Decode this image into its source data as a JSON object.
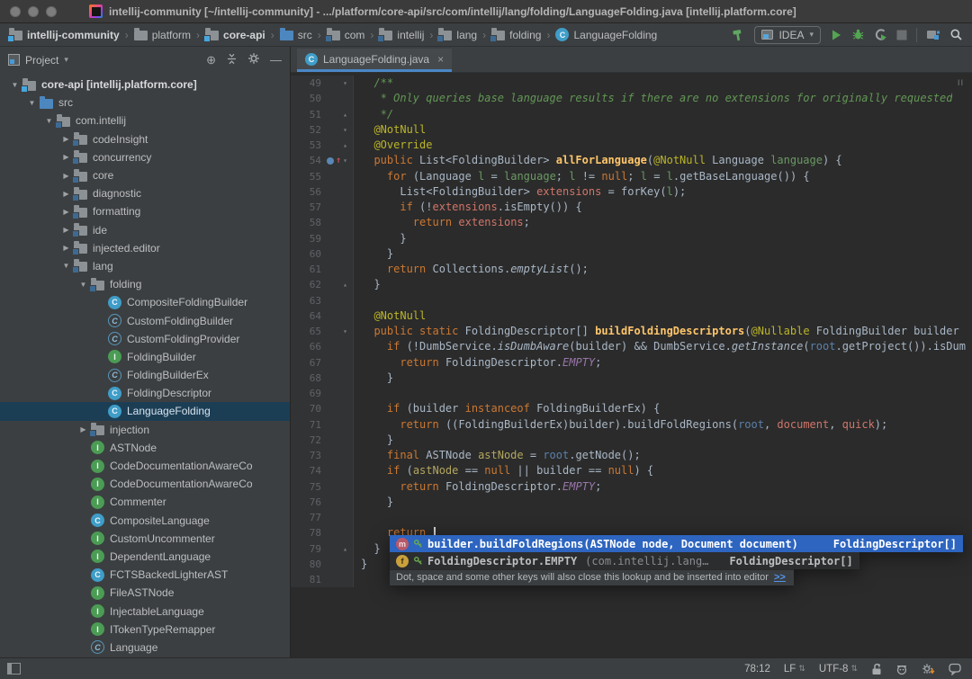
{
  "window": {
    "title": "intellij-community [~/intellij-community] - .../platform/core-api/src/com/intellij/lang/folding/LanguageFolding.java [intellij.platform.core]"
  },
  "glyphs": {
    "expanded": "▼",
    "collapsed": "▶",
    "fold_open": "▾",
    "fold_close": "▴",
    "breadcrumb_sep": "›",
    "dropdown_arrow": "▾",
    "tab_close": "×",
    "updown": "⇅",
    "minus": "—",
    "crosshair": "⊕",
    "override_arrow": "↑"
  },
  "icon_letters": {
    "class": "C",
    "abstract": "C",
    "interface": "I",
    "method": "m",
    "field": "f"
  },
  "colors": {
    "accent_blue": "#4a88c7",
    "tree_selection": "#1c3e55",
    "popup_selection": "#2d65c0",
    "run_green": "#53a552"
  },
  "navbar": {
    "breadcrumbs": [
      {
        "label": "intellij-community",
        "icon": "module",
        "bold": true
      },
      {
        "label": "platform",
        "icon": "folder"
      },
      {
        "label": "core-api",
        "icon": "module",
        "bold": true
      },
      {
        "label": "src",
        "icon": "src"
      },
      {
        "label": "com",
        "icon": "package"
      },
      {
        "label": "intellij",
        "icon": "package"
      },
      {
        "label": "lang",
        "icon": "package"
      },
      {
        "label": "folding",
        "icon": "package"
      },
      {
        "label": "LanguageFolding",
        "icon": "class"
      }
    ],
    "run_config_label": "IDEA"
  },
  "project_panel": {
    "title": "Project",
    "tree": [
      {
        "label": "core-api [intellij.platform.core]",
        "level": 0,
        "arrow": "e",
        "icon": "module",
        "bold": true
      },
      {
        "label": "src",
        "level": 1,
        "arrow": "e",
        "icon": "src"
      },
      {
        "label": "com.intellij",
        "level": 2,
        "arrow": "e",
        "icon": "package"
      },
      {
        "label": "codeInsight",
        "level": 3,
        "arrow": "c",
        "icon": "package"
      },
      {
        "label": "concurrency",
        "level": 3,
        "arrow": "c",
        "icon": "package"
      },
      {
        "label": "core",
        "level": 3,
        "arrow": "c",
        "icon": "package"
      },
      {
        "label": "diagnostic",
        "level": 3,
        "arrow": "c",
        "icon": "package"
      },
      {
        "label": "formatting",
        "level": 3,
        "arrow": "c",
        "icon": "package"
      },
      {
        "label": "ide",
        "level": 3,
        "arrow": "c",
        "icon": "package"
      },
      {
        "label": "injected.editor",
        "level": 3,
        "arrow": "c",
        "icon": "package"
      },
      {
        "label": "lang",
        "level": 3,
        "arrow": "e",
        "icon": "package"
      },
      {
        "label": "folding",
        "level": 4,
        "arrow": "e",
        "icon": "package"
      },
      {
        "label": "CompositeFoldingBuilder",
        "level": 5,
        "icon": "class"
      },
      {
        "label": "CustomFoldingBuilder",
        "level": 5,
        "icon": "abstract"
      },
      {
        "label": "CustomFoldingProvider",
        "level": 5,
        "icon": "abstract"
      },
      {
        "label": "FoldingBuilder",
        "level": 5,
        "icon": "interface"
      },
      {
        "label": "FoldingBuilderEx",
        "level": 5,
        "icon": "abstract"
      },
      {
        "label": "FoldingDescriptor",
        "level": 5,
        "icon": "class"
      },
      {
        "label": "LanguageFolding",
        "level": 5,
        "icon": "class",
        "selected": true
      },
      {
        "label": "injection",
        "level": 4,
        "arrow": "c",
        "icon": "package"
      },
      {
        "label": "ASTNode",
        "level": 4,
        "icon": "interface"
      },
      {
        "label": "CodeDocumentationAwareCo",
        "level": 4,
        "icon": "interface"
      },
      {
        "label": "CodeDocumentationAwareCo",
        "level": 4,
        "icon": "interface"
      },
      {
        "label": "Commenter",
        "level": 4,
        "icon": "interface"
      },
      {
        "label": "CompositeLanguage",
        "level": 4,
        "icon": "class"
      },
      {
        "label": "CustomUncommenter",
        "level": 4,
        "icon": "interface"
      },
      {
        "label": "DependentLanguage",
        "level": 4,
        "icon": "interface"
      },
      {
        "label": "FCTSBackedLighterAST",
        "level": 4,
        "icon": "class"
      },
      {
        "label": "FileASTNode",
        "level": 4,
        "icon": "interface"
      },
      {
        "label": "InjectableLanguage",
        "level": 4,
        "icon": "interface"
      },
      {
        "label": "ITokenTypeRemapper",
        "level": 4,
        "icon": "interface"
      },
      {
        "label": "Language",
        "level": 4,
        "icon": "abstract"
      }
    ]
  },
  "editor": {
    "tab_label": "LanguageFolding.java",
    "stripe_marker": "II",
    "lines": [
      {
        "n": 49,
        "f": "o",
        "s": [
          [
            "  /**",
            "c"
          ]
        ]
      },
      {
        "n": 50,
        "s": [
          [
            "   * Only queries base language results if there are no extensions for originally requested",
            "c"
          ]
        ]
      },
      {
        "n": 51,
        "f": "c",
        "s": [
          [
            "   */",
            "c"
          ]
        ]
      },
      {
        "n": 52,
        "f": "o",
        "s": [
          [
            "  ",
            "d"
          ],
          [
            "@NotNull",
            "a"
          ]
        ]
      },
      {
        "n": 53,
        "f": "c",
        "s": [
          [
            "  ",
            "d"
          ],
          [
            "@Override",
            "a"
          ]
        ]
      },
      {
        "n": 54,
        "f": "o",
        "ov": true,
        "s": [
          [
            "  ",
            "d"
          ],
          [
            "public ",
            "k"
          ],
          [
            "List<FoldingBuilder> ",
            "d"
          ],
          [
            "allForLanguage",
            "m"
          ],
          [
            "(",
            "d"
          ],
          [
            "@NotNull",
            "a"
          ],
          [
            " Language ",
            "d"
          ],
          [
            "language",
            "vg"
          ],
          [
            ") {",
            "d"
          ]
        ]
      },
      {
        "n": 55,
        "s": [
          [
            "    ",
            "d"
          ],
          [
            "for",
            "k"
          ],
          [
            " (Language ",
            "d"
          ],
          [
            "l",
            "vg"
          ],
          [
            " = ",
            "d"
          ],
          [
            "language",
            "vg"
          ],
          [
            "; ",
            "d"
          ],
          [
            "l",
            "vg"
          ],
          [
            " != ",
            "d"
          ],
          [
            "null",
            "k"
          ],
          [
            "; ",
            "d"
          ],
          [
            "l",
            "vg"
          ],
          [
            " = ",
            "d"
          ],
          [
            "l",
            "vg"
          ],
          [
            ".getBaseLanguage()) {",
            "d"
          ]
        ]
      },
      {
        "n": 56,
        "s": [
          [
            "      List<FoldingBuilder> ",
            "d"
          ],
          [
            "extensions",
            "vs"
          ],
          [
            " = forKey(",
            "d"
          ],
          [
            "l",
            "vg"
          ],
          [
            ");",
            "d"
          ]
        ]
      },
      {
        "n": 57,
        "s": [
          [
            "      ",
            "d"
          ],
          [
            "if",
            "k"
          ],
          [
            " (!",
            "d"
          ],
          [
            "extensions",
            "vs"
          ],
          [
            ".isEmpty()) {",
            "d"
          ]
        ]
      },
      {
        "n": 58,
        "s": [
          [
            "        ",
            "d"
          ],
          [
            "return",
            "k"
          ],
          [
            " ",
            "d"
          ],
          [
            "extensions",
            "vs"
          ],
          [
            ";",
            "d"
          ]
        ]
      },
      {
        "n": 59,
        "s": [
          [
            "      }",
            "d"
          ]
        ]
      },
      {
        "n": 60,
        "s": [
          [
            "    }",
            "d"
          ]
        ]
      },
      {
        "n": 61,
        "s": [
          [
            "    ",
            "d"
          ],
          [
            "return",
            "k"
          ],
          [
            " Collections.",
            "d"
          ],
          [
            "emptyList",
            "st"
          ],
          [
            "();",
            "d"
          ]
        ]
      },
      {
        "n": 62,
        "f": "c",
        "s": [
          [
            "  }",
            "d"
          ]
        ]
      },
      {
        "n": 63,
        "s": []
      },
      {
        "n": 64,
        "s": [
          [
            "  ",
            "d"
          ],
          [
            "@NotNull",
            "a"
          ]
        ]
      },
      {
        "n": 65,
        "f": "o",
        "s": [
          [
            "  ",
            "d"
          ],
          [
            "public static ",
            "k"
          ],
          [
            "FoldingDescriptor[] ",
            "d"
          ],
          [
            "buildFoldingDescriptors",
            "m"
          ],
          [
            "(",
            "d"
          ],
          [
            "@Nullable",
            "a"
          ],
          [
            " FoldingBuilder builder",
            "d"
          ]
        ]
      },
      {
        "n": 66,
        "s": [
          [
            "    ",
            "d"
          ],
          [
            "if",
            "k"
          ],
          [
            " (!DumbService.",
            "d"
          ],
          [
            "isDumbAware",
            "st"
          ],
          [
            "(builder) && DumbService.",
            "d"
          ],
          [
            "getInstance",
            "st"
          ],
          [
            "(",
            "d"
          ],
          [
            "root",
            "vb"
          ],
          [
            ".getProject()).isDum",
            "d"
          ]
        ]
      },
      {
        "n": 67,
        "s": [
          [
            "      ",
            "d"
          ],
          [
            "return",
            "k"
          ],
          [
            " FoldingDescriptor.",
            "d"
          ],
          [
            "EMPTY",
            "p"
          ],
          [
            ";",
            "d"
          ]
        ]
      },
      {
        "n": 68,
        "s": [
          [
            "    }",
            "d"
          ]
        ]
      },
      {
        "n": 69,
        "s": []
      },
      {
        "n": 70,
        "s": [
          [
            "    ",
            "d"
          ],
          [
            "if",
            "k"
          ],
          [
            " (builder ",
            "d"
          ],
          [
            "instanceof",
            "k"
          ],
          [
            " FoldingBuilderEx) {",
            "d"
          ]
        ]
      },
      {
        "n": 71,
        "s": [
          [
            "      ",
            "d"
          ],
          [
            "return",
            "k"
          ],
          [
            " ((FoldingBuilderEx)builder).buildFoldRegions(",
            "d"
          ],
          [
            "root",
            "vb"
          ],
          [
            ", ",
            "d"
          ],
          [
            "document",
            "vs"
          ],
          [
            ", ",
            "d"
          ],
          [
            "quick",
            "vs"
          ],
          [
            ");",
            "d"
          ]
        ]
      },
      {
        "n": 72,
        "s": [
          [
            "    }",
            "d"
          ]
        ]
      },
      {
        "n": 73,
        "s": [
          [
            "    ",
            "d"
          ],
          [
            "final ",
            "k"
          ],
          [
            "ASTNode ",
            "d"
          ],
          [
            "astNode",
            "vy"
          ],
          [
            " = ",
            "d"
          ],
          [
            "root",
            "vb"
          ],
          [
            ".getNode();",
            "d"
          ]
        ]
      },
      {
        "n": 74,
        "s": [
          [
            "    ",
            "d"
          ],
          [
            "if",
            "k"
          ],
          [
            " (",
            "d"
          ],
          [
            "astNode",
            "vy"
          ],
          [
            " == ",
            "d"
          ],
          [
            "null",
            "k"
          ],
          [
            " || builder == ",
            "d"
          ],
          [
            "null",
            "k"
          ],
          [
            ") {",
            "d"
          ]
        ]
      },
      {
        "n": 75,
        "s": [
          [
            "      ",
            "d"
          ],
          [
            "return",
            "k"
          ],
          [
            " FoldingDescriptor.",
            "d"
          ],
          [
            "EMPTY",
            "p"
          ],
          [
            ";",
            "d"
          ]
        ]
      },
      {
        "n": 76,
        "s": [
          [
            "    }",
            "d"
          ]
        ]
      },
      {
        "n": 77,
        "s": []
      },
      {
        "n": 78,
        "caret": true,
        "s": [
          [
            "    ",
            "d"
          ],
          [
            "return",
            "k"
          ],
          [
            " ",
            "d"
          ]
        ]
      },
      {
        "n": 79,
        "f": "c",
        "s": [
          [
            "  }",
            "d"
          ]
        ]
      },
      {
        "n": 80,
        "s": [
          [
            "}",
            "d"
          ]
        ]
      },
      {
        "n": 81,
        "s": []
      }
    ]
  },
  "completion": {
    "items": [
      {
        "icon": "method",
        "main": "builder.buildFoldRegions(ASTNode node, Document document)",
        "tail": "",
        "type": "FoldingDescriptor[]",
        "selected": true
      },
      {
        "icon": "field",
        "main": "FoldingDescriptor.EMPTY",
        "tail": "(com.intellij.lang…",
        "type": "FoldingDescriptor[]",
        "selected": false
      }
    ],
    "hint": "Dot, space and some other keys will also close this lookup and be inserted into editor",
    "hint_link": ">>"
  },
  "status_bar": {
    "caret_position": "78:12",
    "line_separator": "LF",
    "encoding": "UTF-8"
  }
}
